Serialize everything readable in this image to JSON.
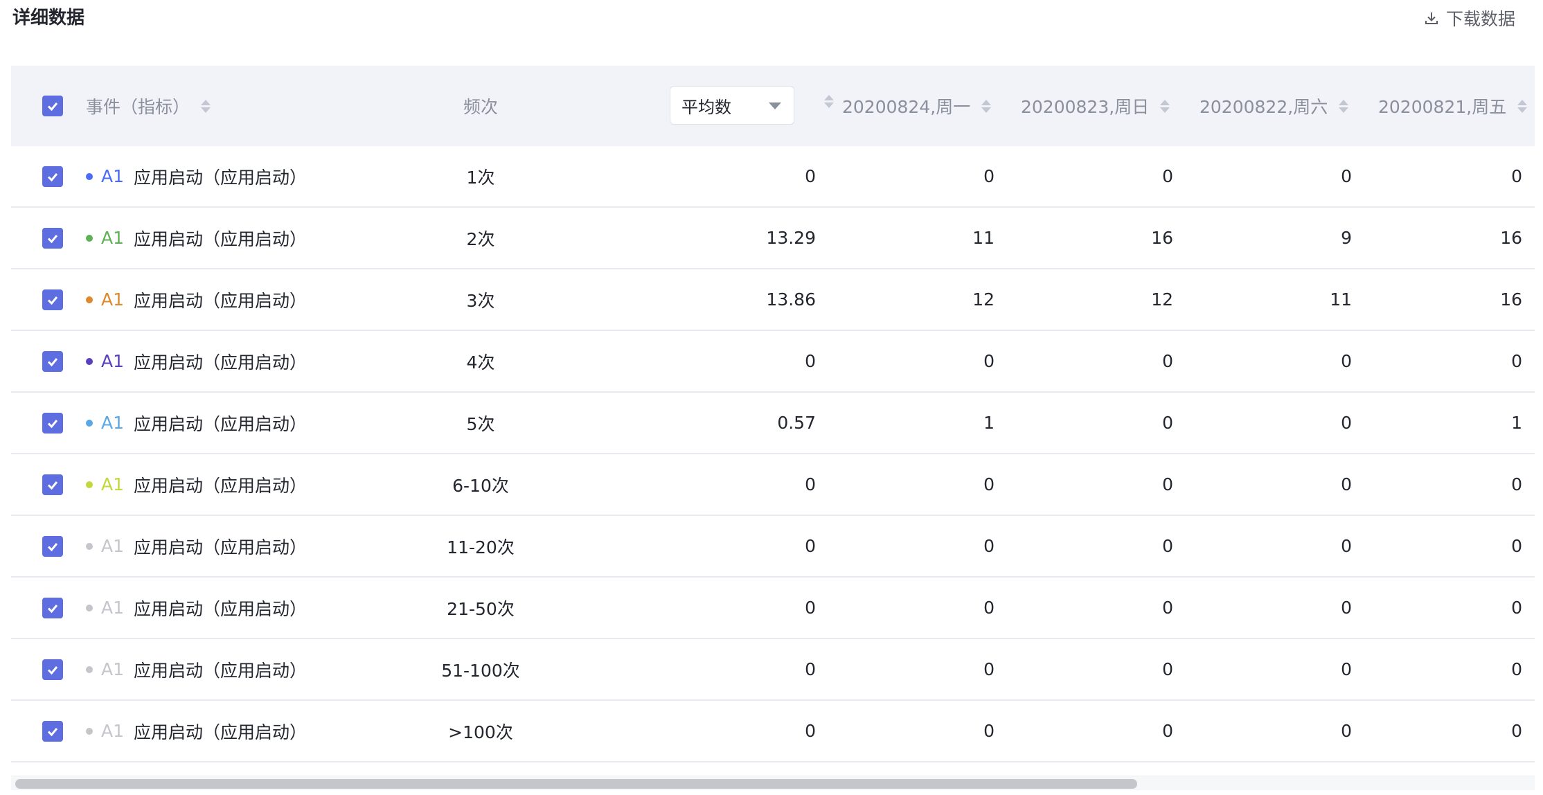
{
  "header": {
    "title": "详细数据",
    "download_label": "下载数据"
  },
  "table": {
    "columns": {
      "event": "事件（指标）",
      "frequency": "频次",
      "avg_select": "平均数",
      "date1": "20200824,周一",
      "date2": "20200823,周日",
      "date3": "20200822,周六",
      "date4": "20200821,周五"
    },
    "rows": [
      {
        "color": "#4a6cf7",
        "code": "A1",
        "name": "应用启动（应用启动）",
        "freq": "1次",
        "avg": "0",
        "d1": "0",
        "d2": "0",
        "d3": "0",
        "d4": "0"
      },
      {
        "color": "#5fb157",
        "code": "A1",
        "name": "应用启动（应用启动）",
        "freq": "2次",
        "avg": "13.29",
        "d1": "11",
        "d2": "16",
        "d3": "9",
        "d4": "16"
      },
      {
        "color": "#dd8a2e",
        "code": "A1",
        "name": "应用启动（应用启动）",
        "freq": "3次",
        "avg": "13.86",
        "d1": "12",
        "d2": "12",
        "d3": "11",
        "d4": "16"
      },
      {
        "color": "#5a3fbf",
        "code": "A1",
        "name": "应用启动（应用启动）",
        "freq": "4次",
        "avg": "0",
        "d1": "0",
        "d2": "0",
        "d3": "0",
        "d4": "0"
      },
      {
        "color": "#5aa8e6",
        "code": "A1",
        "name": "应用启动（应用启动）",
        "freq": "5次",
        "avg": "0.57",
        "d1": "1",
        "d2": "0",
        "d3": "0",
        "d4": "1"
      },
      {
        "color": "#c3d83a",
        "code": "A1",
        "name": "应用启动（应用启动）",
        "freq": "6-10次",
        "avg": "0",
        "d1": "0",
        "d2": "0",
        "d3": "0",
        "d4": "0"
      },
      {
        "color": "#c4c6cc",
        "code": "A1",
        "name": "应用启动（应用启动）",
        "freq": "11-20次",
        "avg": "0",
        "d1": "0",
        "d2": "0",
        "d3": "0",
        "d4": "0"
      },
      {
        "color": "#c4c6cc",
        "code": "A1",
        "name": "应用启动（应用启动）",
        "freq": "21-50次",
        "avg": "0",
        "d1": "0",
        "d2": "0",
        "d3": "0",
        "d4": "0"
      },
      {
        "color": "#c4c6cc",
        "code": "A1",
        "name": "应用启动（应用启动）",
        "freq": "51-100次",
        "avg": "0",
        "d1": "0",
        "d2": "0",
        "d3": "0",
        "d4": "0"
      },
      {
        "color": "#c4c6cc",
        "code": "A1",
        "name": "应用启动（应用启动）",
        "freq": ">100次",
        "avg": "0",
        "d1": "0",
        "d2": "0",
        "d3": "0",
        "d4": "0"
      }
    ]
  },
  "icons": {
    "download": "download-icon",
    "checkbox": "check-icon",
    "sort": "sort-icon",
    "caret": "caret-down-icon"
  },
  "colors": {
    "accent": "#5e6de0",
    "header_bg": "#f1f3f8"
  }
}
